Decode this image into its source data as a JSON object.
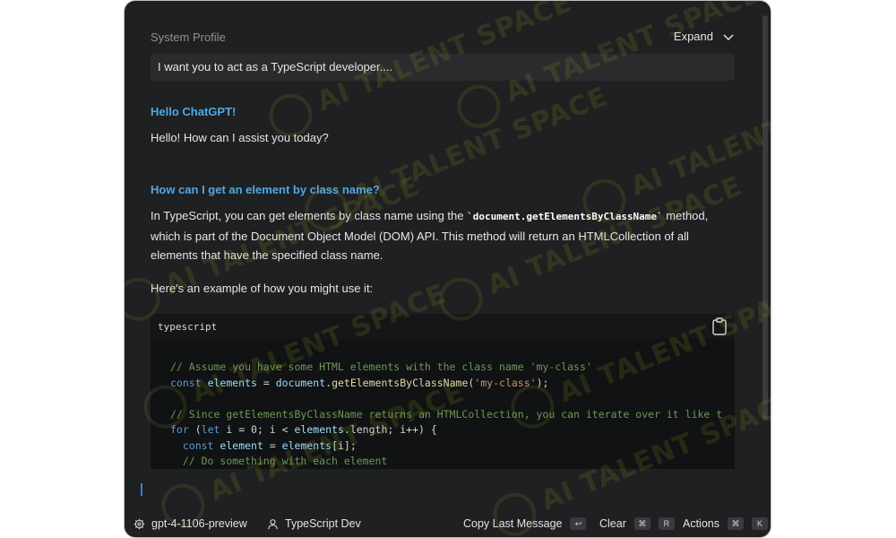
{
  "system_profile": {
    "label": "System Profile",
    "expand_label": "Expand",
    "value": "I want you to act as a TypeScript developer...."
  },
  "conversation": {
    "q1": "Hello ChatGPT!",
    "a1": "Hello! How can I assist you today?",
    "q2": "How can I get an element by class name?",
    "a2_part1": "In TypeScript, you can get elements by class name using the ",
    "a2_code": "`document.getElementsByClassName`",
    "a2_part2": " method, which is part of the Document Object Model (DOM) API. This method will return an HTMLCollection of all elements that have the specified class name.",
    "a3": "Here's an example of how you might use it:"
  },
  "code_block": {
    "language": "typescript",
    "line1": "// Assume you have some HTML elements with the class name 'my-class'",
    "line2": {
      "kw": "const",
      "var": "elements",
      "eq": " = ",
      "obj": "document",
      "fn": "getElementsByClassName",
      "arg": "'my-class'"
    },
    "line4": "// Since getElementsByClassName returns an HTMLCollection, you can iterate over it like t",
    "line5": {
      "kw1": "for",
      "kw2": "let",
      "rest1": " i = 0; i < ",
      "var": "elements",
      "rest2": ".length; i++) {"
    },
    "line6": {
      "kw": "const",
      "var": "element",
      "rest": " = ",
      "arr": "elements",
      "idx": "[i];"
    },
    "line7": "// Do something with each element"
  },
  "footer": {
    "model": "gpt-4-1106-preview",
    "profile": "TypeScript Dev",
    "copy_last": "Copy Last Message",
    "copy_key": "↩",
    "clear": "Clear",
    "clear_key1": "⌘",
    "clear_key2": "R",
    "actions": "Actions",
    "actions_key1": "⌘",
    "actions_key2": "K"
  },
  "watermark_text": "AI TALENT SPACE",
  "colors": {
    "window_bg": "#1f2021",
    "question": "#4ea8e8",
    "caret": "#3d7fd0",
    "watermark": "#96a828"
  }
}
